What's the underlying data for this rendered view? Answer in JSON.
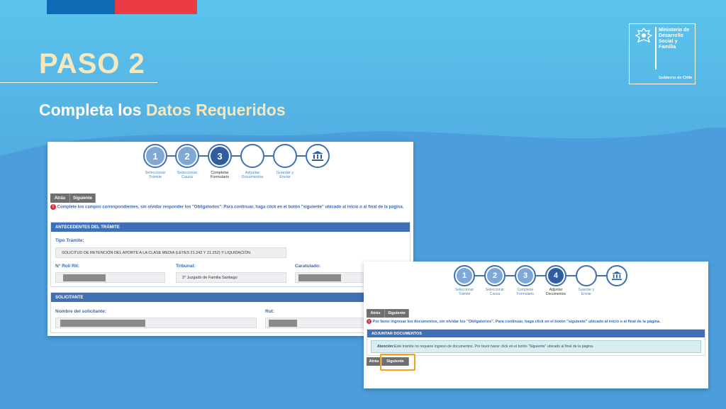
{
  "header": {
    "paso": "PASO 2",
    "subtitle_prefix": "Completa los ",
    "subtitle_highlight": "Datos Requeridos"
  },
  "gov_logo": {
    "ministry_lines": [
      "Ministerio de",
      "Desarrollo",
      "Social y",
      "Familia"
    ],
    "gobierno": "Gobierno de Chile"
  },
  "form_step3": {
    "steps": [
      {
        "number": "1",
        "label_lines": [
          "Seleccionar",
          "Trámite"
        ],
        "state": "done"
      },
      {
        "number": "2",
        "label_lines": [
          "Seleccionar",
          "Causa"
        ],
        "state": "done"
      },
      {
        "number": "3",
        "label_lines": [
          "Completar",
          "Formulario"
        ],
        "state": "current"
      },
      {
        "number": "",
        "label_lines": [
          "Adjuntar",
          "Documentos"
        ],
        "state": "todo"
      },
      {
        "number": "",
        "label_lines": [
          "Guardar y",
          "Enviar"
        ],
        "state": "todo"
      },
      {
        "number": "",
        "label_lines": [],
        "state": "icon"
      }
    ],
    "btn_back": "Atrás",
    "btn_next": "Siguiente",
    "warning": "Complete los campos correspondientes, sin olvidar responder los \"Obligatorios\". Para continuar, haga click en el botón \"siguiente\" ubicado al inicio o al final de la página.",
    "antecedentes": {
      "title": "ANTECEDENTES DEL TRÁMITE",
      "tipo_label": "Tipo Trámite:",
      "tipo_value": "SOLICITUD DE RETENCIÓN DEL APORTE A LA CLASE MEDIA (LEYES 21.242 Y 21.252) Y LIQUIDACIÓN.",
      "rol_label": "N° Rol/ Rit:",
      "tribunal_label": "Tribunal:",
      "tribunal_value": "2° Juzgado de Familia Santiago",
      "caratulado_label": "Caratulado:"
    },
    "solicitante": {
      "title": "SOLICITANTE",
      "nombre_label": "Nombre del solicitante:",
      "rut_label": "Rut:"
    }
  },
  "form_step4": {
    "steps": [
      {
        "number": "1",
        "label_lines": [
          "Seleccionar",
          "Trámite"
        ],
        "state": "done"
      },
      {
        "number": "2",
        "label_lines": [
          "Seleccionar",
          "Causa"
        ],
        "state": "done"
      },
      {
        "number": "3",
        "label_lines": [
          "Completar",
          "Formulario"
        ],
        "state": "done"
      },
      {
        "number": "4",
        "label_lines": [
          "Adjuntar",
          "Documentos"
        ],
        "state": "current"
      },
      {
        "number": "",
        "label_lines": [
          "Guardar y",
          "Enviar"
        ],
        "state": "todo"
      },
      {
        "number": "",
        "label_lines": [],
        "state": "icon"
      }
    ],
    "btn_back": "Atrás",
    "btn_next": "Siguiente",
    "warning": "Por favor ingresar los documentos, sin olvidar los \"Obligatorios\". Para continuar, haga click en el botón \"siguiente\" ubicado al inicio o al final de la página.",
    "adjuntar": {
      "title": "ADJUNTAR DOCUMENTOS",
      "notice_strong": "Atención:",
      "notice_text": " Este trámite no requiere ingreso de documentos. Por favor hacer click en el botón \"Siguiente\" ubicado al final de la página."
    },
    "btn_back_bottom": "Atrás",
    "btn_next_bottom": "Siguiente"
  },
  "colors": {
    "accent_blue": "#3f6fb5",
    "cream": "#f6e7bd",
    "highlight_orange": "#f2a31b",
    "warning_red": "#d9303f"
  }
}
